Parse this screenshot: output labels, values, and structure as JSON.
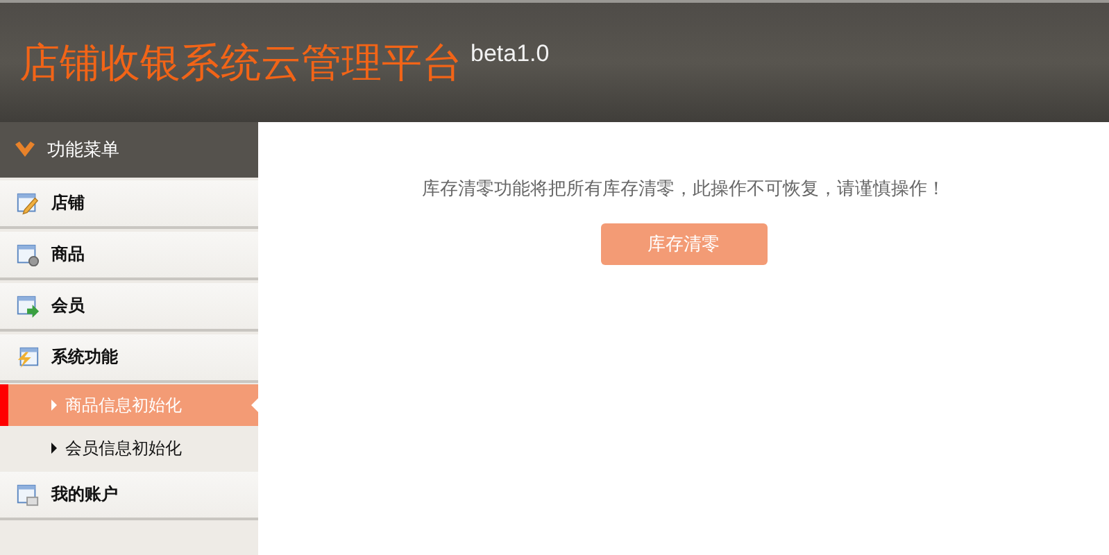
{
  "header": {
    "title": "店铺收银系统云管理平台",
    "version": "beta1.0"
  },
  "sidebar": {
    "menu_title": "功能菜单",
    "items": [
      {
        "label": "店铺"
      },
      {
        "label": "商品"
      },
      {
        "label": "会员"
      },
      {
        "label": "系统功能",
        "children": [
          {
            "label": "商品信息初始化",
            "selected": true
          },
          {
            "label": "会员信息初始化",
            "selected": false
          }
        ]
      },
      {
        "label": "我的账户"
      }
    ]
  },
  "content": {
    "message": "库存清零功能将把所有库存清零，此操作不可恢复，请谨慎操作！",
    "button": "库存清零"
  }
}
